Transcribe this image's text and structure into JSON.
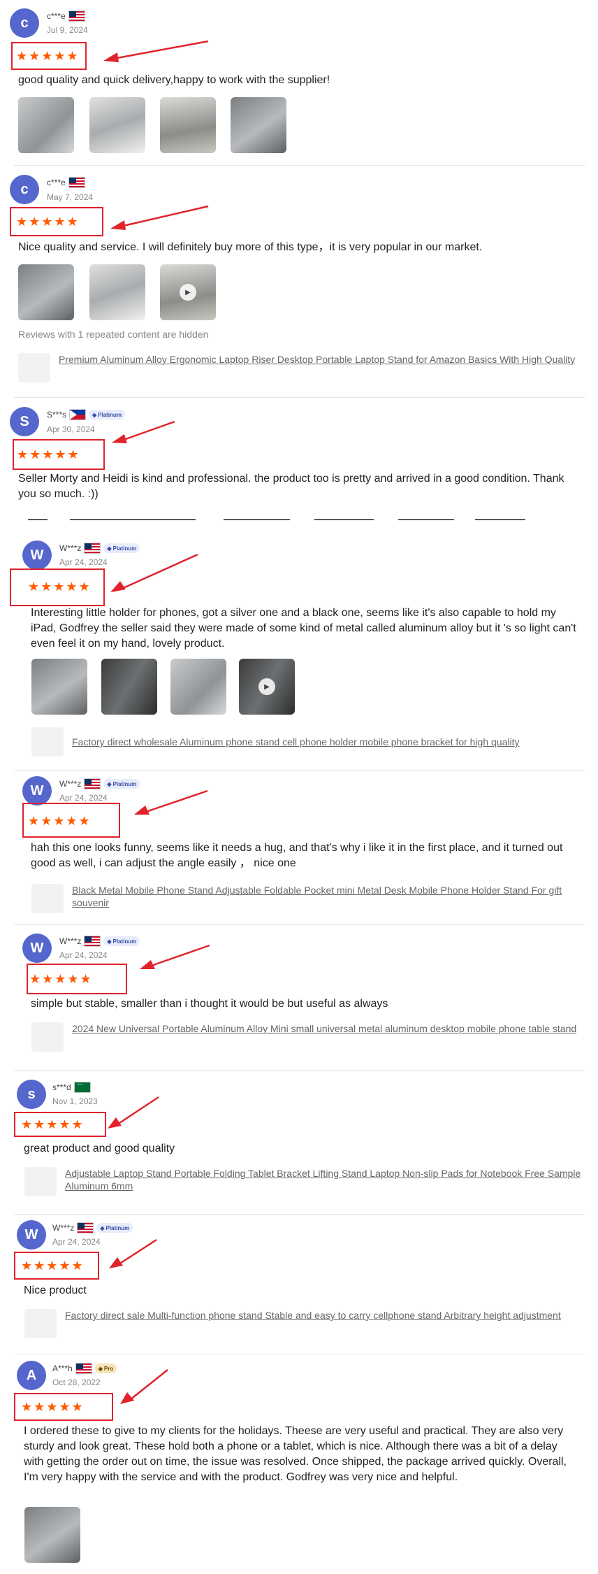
{
  "icons": {
    "star": "star-icon",
    "play": "play-icon",
    "diamond": "diamond-icon",
    "avatar": "avatar"
  },
  "colors": {
    "star": "#ff5a00",
    "highlight_box": "#e0232a",
    "avatar": "#5566cc",
    "badge_bg": "#e8ecfa"
  },
  "reviews": [
    {
      "initial": "c",
      "name": "c***e",
      "flag": "US",
      "date": "Jul 9, 2024",
      "stars": "★★★★★",
      "text": "good quality and quick delivery,happy to work with the supplier!",
      "images": 4
    },
    {
      "initial": "c",
      "name": "c***e",
      "flag": "US",
      "date": "May 7, 2024",
      "stars": "★★★★★",
      "text": "Nice quality and service. I will definitely buy more of this type，it is very popular in our market.",
      "images": 3,
      "hidden_note": "Reviews with 1 repeated content are hidden",
      "product": "Premium Aluminum Alloy Ergonomic Laptop Riser Desktop Portable Laptop Stand for Amazon Basics With High Quality"
    },
    {
      "initial": "S",
      "name": "S***s",
      "flag": "PH",
      "badge": "Platinum",
      "date": "Apr 30, 2024",
      "stars": "★★★★★",
      "text": "Seller Morty and Heidi is kind and professional. the product too is pretty and arrived in a good condition. Thank you so much. :))"
    },
    {
      "initial": "W",
      "name": "W***z",
      "flag": "US",
      "badge": "Platinum",
      "date": "Apr 24, 2024",
      "stars": "★★★★★",
      "text": "Interesting little holder for phones, got a silver one and a black one, seems like it's also capable to hold my iPad, Godfrey the seller said they were made of some kind of metal called aluminum alloy but it 's so light can't even feel it on my hand, lovely product.",
      "images": 4,
      "product": "Factory direct wholesale Aluminum phone stand cell phone holder mobile phone bracket for high quality"
    },
    {
      "initial": "W",
      "name": "W***z",
      "flag": "US",
      "badge": "Platinum",
      "date": "Apr 24, 2024",
      "stars": "★★★★★",
      "text": "hah this one looks funny, seems like it needs a hug, and that's why i like it in the first place, and it turned out good as well, i can adjust the angle easily ，  nice one",
      "product": "Black Metal Mobile Phone Stand Adjustable Foldable Pocket mini Metal Desk Mobile Phone Holder Stand For gift souvenir"
    },
    {
      "initial": "W",
      "name": "W***z",
      "flag": "US",
      "badge": "Platinum",
      "date": "Apr 24, 2024",
      "stars": "★★★★★",
      "text": "simple but stable, smaller than i thought it would be but useful as always",
      "product": "2024 New Universal Portable Aluminum Alloy Mini small universal metal aluminum desktop mobile phone table stand"
    },
    {
      "initial": "s",
      "name": "s***d",
      "flag": "SA",
      "date": "Nov 1, 2023",
      "stars": "★★★★★",
      "text": "great product and good quality",
      "product": "Adjustable Laptop Stand Portable Folding Tablet Bracket Lifting Stand Laptop Non-slip Pads for Notebook Free Sample Aluminum 6mm"
    },
    {
      "initial": "W",
      "name": "W***z",
      "flag": "US",
      "badge": "Platinum",
      "date": "Apr 24, 2024",
      "stars": "★★★★★",
      "text": "Nice product",
      "product": "Factory direct sale Multi-function phone stand Stable and easy to carry cellphone stand Arbitrary height adjustment"
    },
    {
      "initial": "A",
      "name": "A***h",
      "flag": "US",
      "badge": "Pro",
      "date": "Oct 28, 2022",
      "stars": "★★★★★",
      "text": "I ordered these to give to my clients for the holidays. Theese are very useful and practical. They are also very sturdy and look great. These hold both a phone or a tablet, which is nice. Although there was a bit of a delay with getting the order out on time, the issue was resolved. Once shipped, the package arrived quickly. Overall, I'm very happy with the service and with the product. Godfrey was very nice and helpful.",
      "images": 1
    }
  ]
}
